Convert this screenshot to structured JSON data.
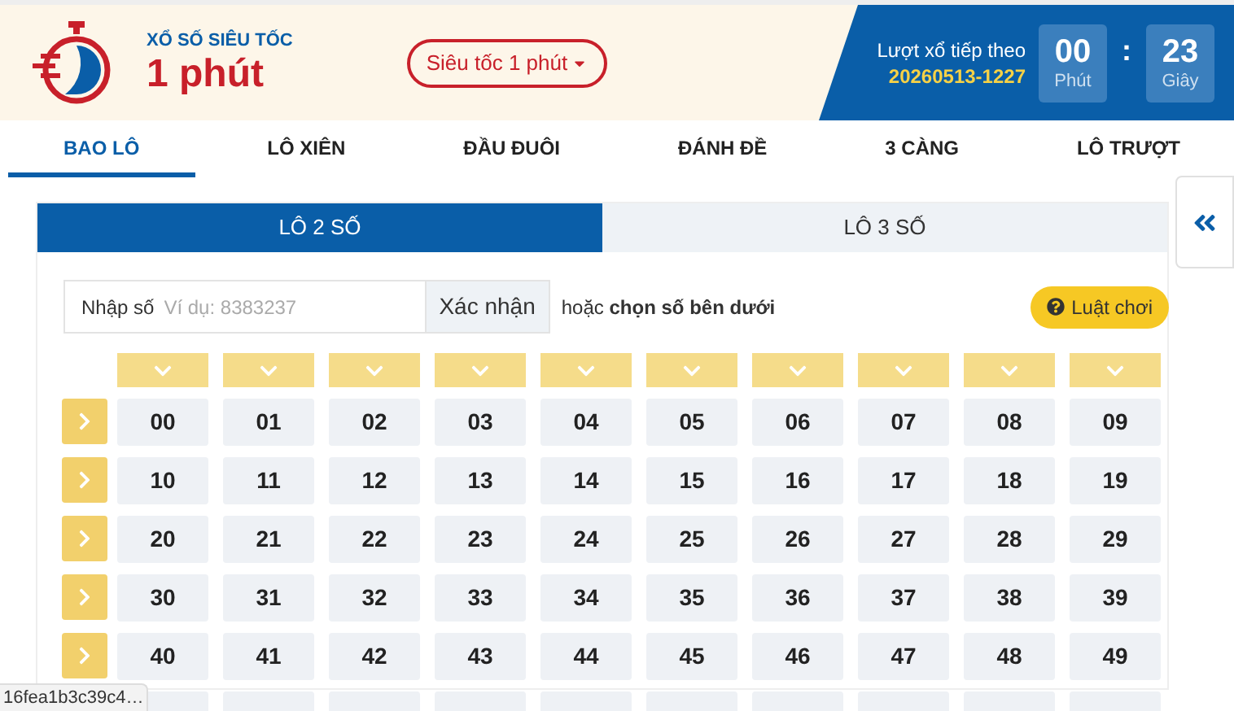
{
  "header": {
    "logo_small": "XỔ SỐ SIÊU TỐC",
    "logo_big": "1 phút",
    "dropdown": "Siêu tốc 1 phút",
    "next_draw_label": "Lượt xổ tiếp theo",
    "draw_id": "20260513-1227",
    "separator": ":",
    "countdown": [
      {
        "value": "00",
        "unit": "Phút"
      },
      {
        "value": "23",
        "unit": "Giây"
      }
    ]
  },
  "nav_tabs": [
    {
      "label": "BAO LÔ",
      "selected": true
    },
    {
      "label": "LÔ XIÊN",
      "selected": false
    },
    {
      "label": "ĐẦU ĐUÔI",
      "selected": false
    },
    {
      "label": "ĐÁNH ĐỀ",
      "selected": false
    },
    {
      "label": "3 CÀNG",
      "selected": false
    },
    {
      "label": "LÔ TRƯỢT",
      "selected": false
    }
  ],
  "sub_tabs": [
    {
      "label": "LÔ 2 SỐ",
      "selected": true
    },
    {
      "label": "LÔ 3 SỐ",
      "selected": false
    }
  ],
  "input": {
    "label": "Nhập số",
    "placeholder": "Ví dụ: 8383237",
    "button": "Xác nhận"
  },
  "hint": "hoặc **chọn số bên dưới**",
  "rules_button": "Luật chơi",
  "number_rows": [
    [
      "00",
      "01",
      "02",
      "03",
      "04",
      "05",
      "06",
      "07",
      "08",
      "09"
    ],
    [
      "10",
      "11",
      "12",
      "13",
      "14",
      "15",
      "16",
      "17",
      "18",
      "19"
    ],
    [
      "20",
      "21",
      "22",
      "23",
      "24",
      "25",
      "26",
      "27",
      "28",
      "29"
    ],
    [
      "30",
      "31",
      "32",
      "33",
      "34",
      "35",
      "36",
      "37",
      "38",
      "39"
    ],
    [
      "40",
      "41",
      "42",
      "43",
      "44",
      "45",
      "46",
      "47",
      "48",
      "49"
    ]
  ],
  "status_url": "16fea1b3c39c4…"
}
